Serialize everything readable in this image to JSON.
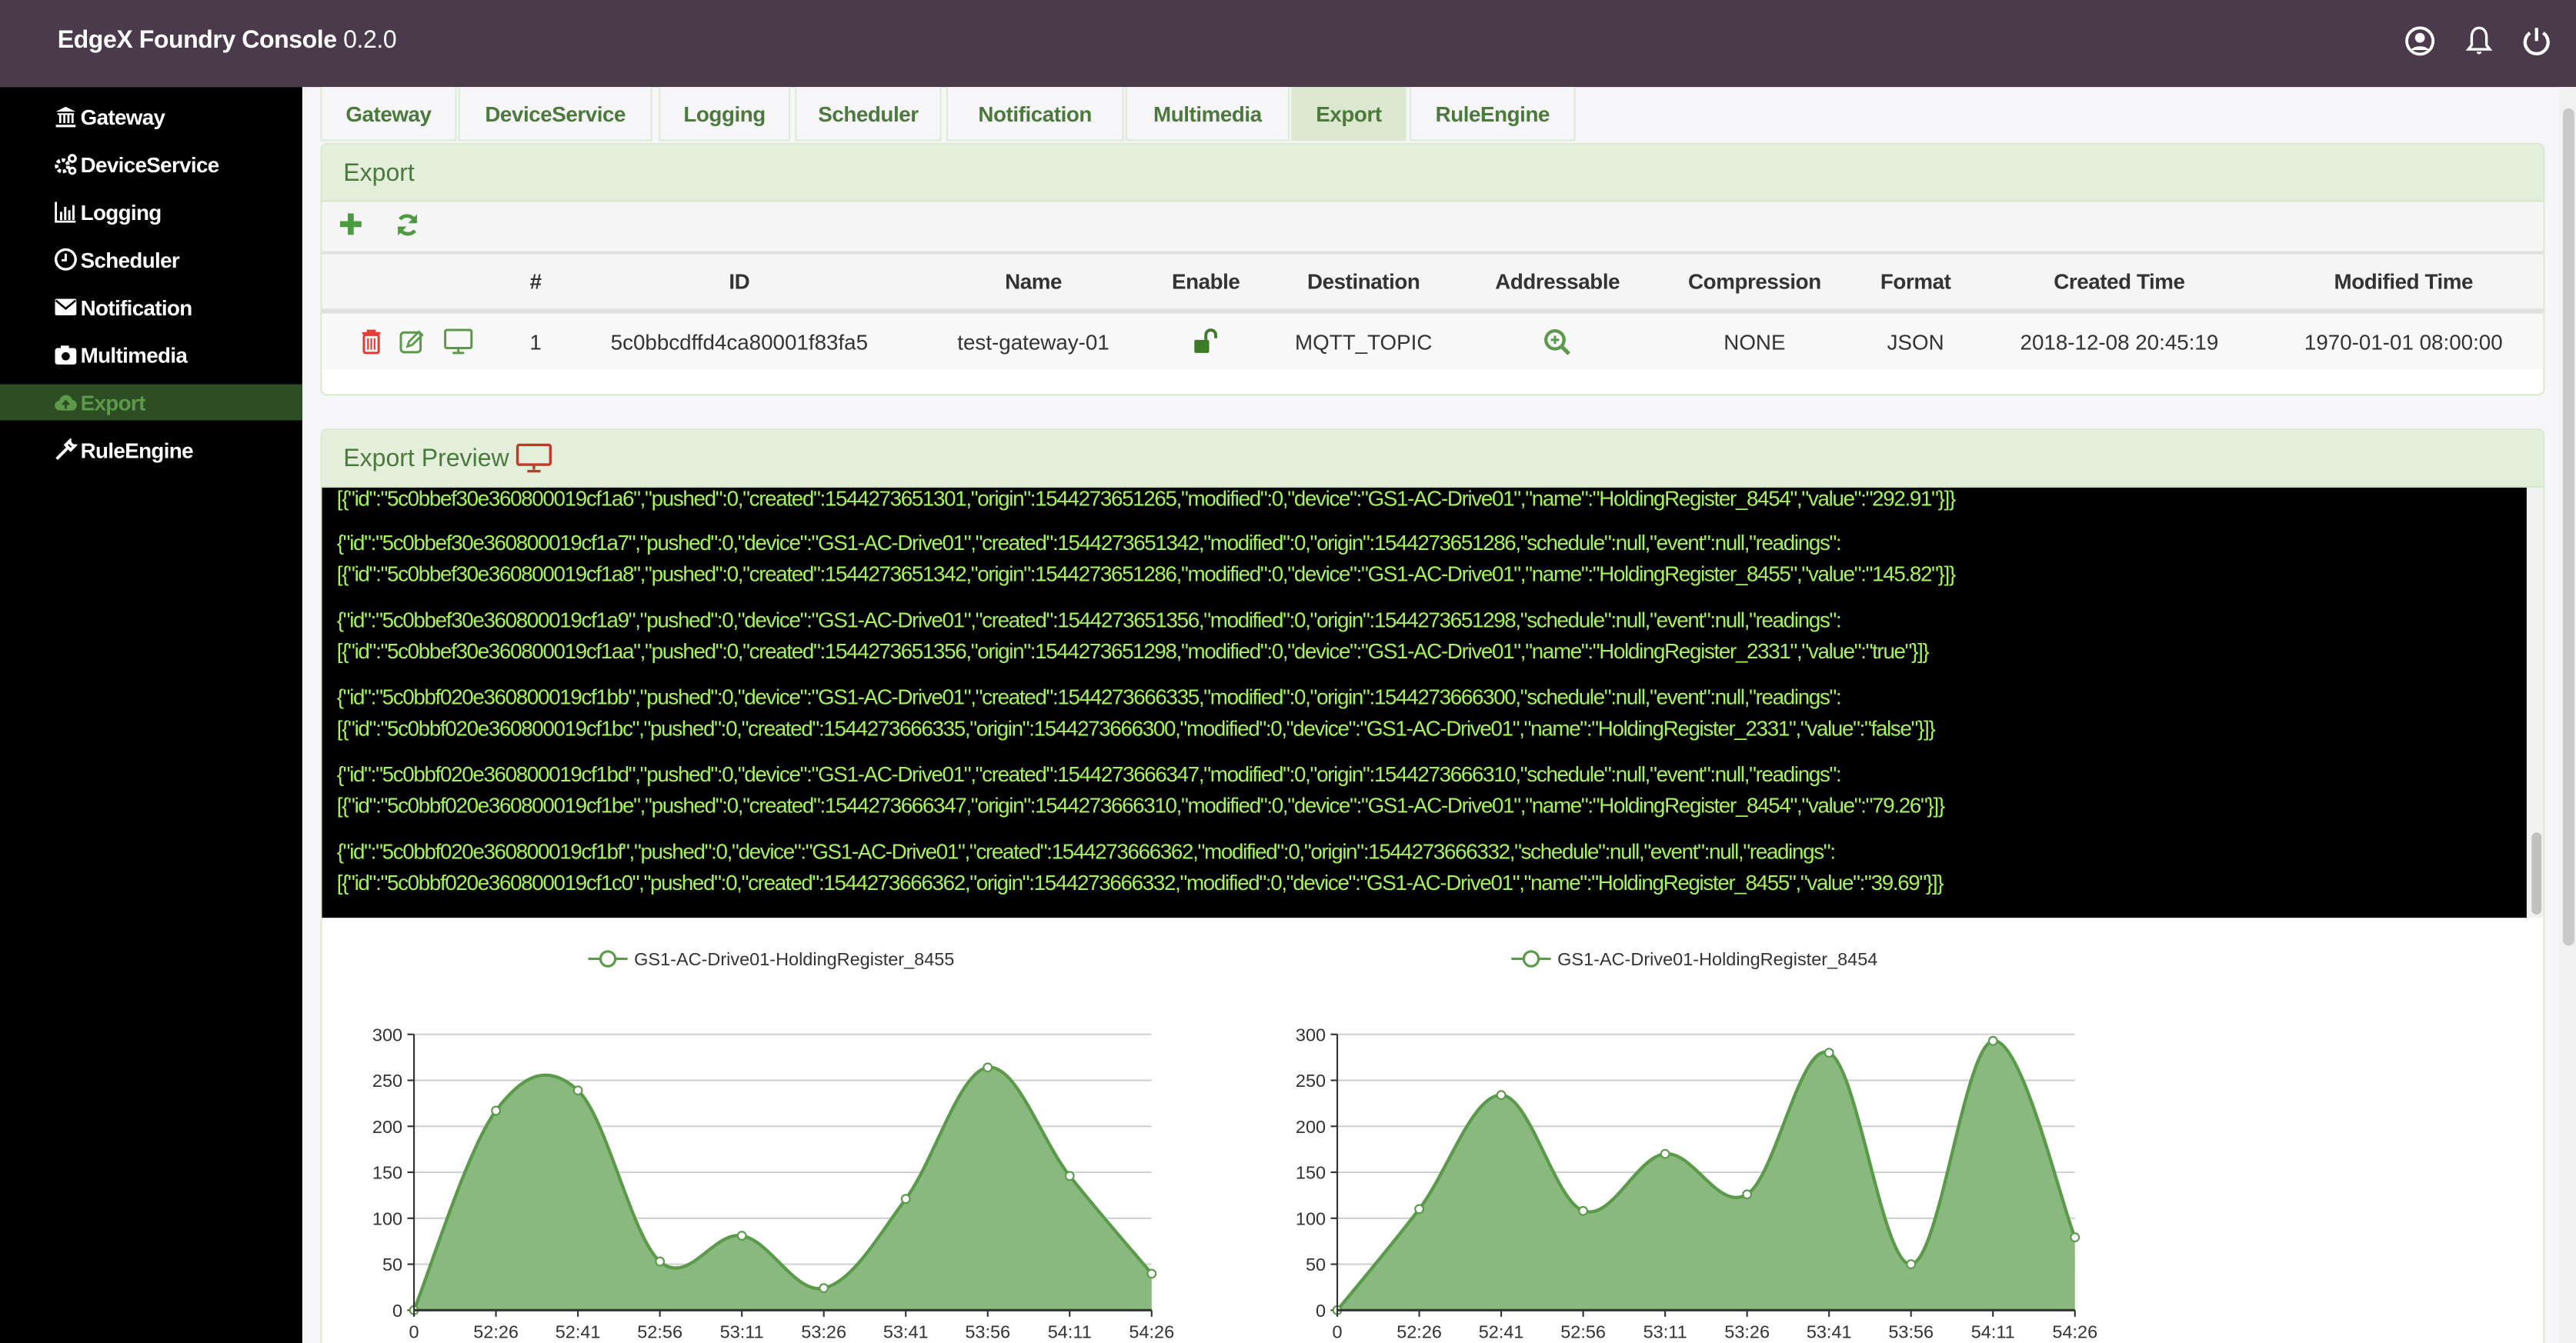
{
  "header": {
    "title": "EdgeX Foundry Console",
    "version": "0.2.0",
    "icons": [
      "user-circle-icon",
      "bell-icon",
      "power-icon"
    ]
  },
  "sidebar": {
    "items": [
      {
        "label": "Gateway",
        "icon": "bank-icon"
      },
      {
        "label": "DeviceService",
        "icon": "cogs-icon"
      },
      {
        "label": "Logging",
        "icon": "bar-chart-icon"
      },
      {
        "label": "Scheduler",
        "icon": "clock-icon"
      },
      {
        "label": "Notification",
        "icon": "envelope-icon"
      },
      {
        "label": "Multimedia",
        "icon": "camera-icon"
      },
      {
        "label": "Export",
        "icon": "cloud-upload-icon",
        "active": true
      },
      {
        "label": "RuleEngine",
        "icon": "wrench-icon"
      }
    ]
  },
  "tabs": [
    {
      "label": "Gateway"
    },
    {
      "label": "DeviceService"
    },
    {
      "label": "Logging"
    },
    {
      "label": "Scheduler"
    },
    {
      "label": "Notification"
    },
    {
      "label": "Multimedia"
    },
    {
      "label": "Export",
      "active": true
    },
    {
      "label": "RuleEngine"
    }
  ],
  "export_panel": {
    "title": "Export",
    "toolbar": {
      "add_icon": "plus-icon",
      "refresh_icon": "refresh-icon"
    },
    "columns": [
      "#",
      "ID",
      "Name",
      "Enable",
      "Destination",
      "Addressable",
      "Compression",
      "Format",
      "Created Time",
      "Modified Time"
    ],
    "rows": [
      {
        "num": "1",
        "id": "5c0bbcdffd4ca80001f83fa5",
        "name": "test-gateway-01",
        "enable": "unlock-icon",
        "destination": "MQTT_TOPIC",
        "addressable": "zoom-in-icon",
        "compression": "NONE",
        "format": "JSON",
        "created": "2018-12-08 20:45:19",
        "modified": "1970-01-01 08:00:00"
      }
    ]
  },
  "preview_panel": {
    "title": "Export Preview",
    "lines": [
      "[{\"id\":\"5c0bbef30e360800019cf1a6\",\"pushed\":0,\"created\":1544273651301,\"origin\":1544273651265,\"modified\":0,\"device\":\"GS1-AC-Drive01\",\"name\":\"HoldingRegister_8454\",\"value\":\"292.91\"}]}",
      "{\"id\":\"5c0bbef30e360800019cf1a7\",\"pushed\":0,\"device\":\"GS1-AC-Drive01\",\"created\":1544273651342,\"modified\":0,\"origin\":1544273651286,\"schedule\":null,\"event\":null,\"readings\":",
      "[{\"id\":\"5c0bbef30e360800019cf1a8\",\"pushed\":0,\"created\":1544273651342,\"origin\":1544273651286,\"modified\":0,\"device\":\"GS1-AC-Drive01\",\"name\":\"HoldingRegister_8455\",\"value\":\"145.82\"}]}",
      "{\"id\":\"5c0bbef30e360800019cf1a9\",\"pushed\":0,\"device\":\"GS1-AC-Drive01\",\"created\":1544273651356,\"modified\":0,\"origin\":1544273651298,\"schedule\":null,\"event\":null,\"readings\":",
      "[{\"id\":\"5c0bbef30e360800019cf1aa\",\"pushed\":0,\"created\":1544273651356,\"origin\":1544273651298,\"modified\":0,\"device\":\"GS1-AC-Drive01\",\"name\":\"HoldingRegister_2331\",\"value\":\"true\"}]}",
      "{\"id\":\"5c0bbf020e360800019cf1bb\",\"pushed\":0,\"device\":\"GS1-AC-Drive01\",\"created\":1544273666335,\"modified\":0,\"origin\":1544273666300,\"schedule\":null,\"event\":null,\"readings\":",
      "[{\"id\":\"5c0bbf020e360800019cf1bc\",\"pushed\":0,\"created\":1544273666335,\"origin\":1544273666300,\"modified\":0,\"device\":\"GS1-AC-Drive01\",\"name\":\"HoldingRegister_2331\",\"value\":\"false\"}]}",
      "{\"id\":\"5c0bbf020e360800019cf1bd\",\"pushed\":0,\"device\":\"GS1-AC-Drive01\",\"created\":1544273666347,\"modified\":0,\"origin\":1544273666310,\"schedule\":null,\"event\":null,\"readings\":",
      "[{\"id\":\"5c0bbf020e360800019cf1be\",\"pushed\":0,\"created\":1544273666347,\"origin\":1544273666310,\"modified\":0,\"device\":\"GS1-AC-Drive01\",\"name\":\"HoldingRegister_8454\",\"value\":\"79.26\"}]}",
      "{\"id\":\"5c0bbf020e360800019cf1bf\",\"pushed\":0,\"device\":\"GS1-AC-Drive01\",\"created\":1544273666362,\"modified\":0,\"origin\":1544273666332,\"schedule\":null,\"event\":null,\"readings\":",
      "[{\"id\":\"5c0bbf020e360800019cf1c0\",\"pushed\":0,\"created\":1544273666362,\"origin\":1544273666332,\"modified\":0,\"device\":\"GS1-AC-Drive01\",\"name\":\"HoldingRegister_8455\",\"value\":\"39.69\"}]}"
    ]
  },
  "colors": {
    "header_bg": "#4a3a4c",
    "accent_green": "#4c7a3c",
    "series_line": "#5a9a4a",
    "series_fill": "#8ab97f",
    "console_text": "#a6f25e",
    "delete_red": "#e53935"
  },
  "chart_data": [
    {
      "type": "area",
      "smooth": true,
      "legend_position": "top-center",
      "grid": "horizontal",
      "categories": [
        "0",
        "52:26",
        "52:41",
        "52:56",
        "53:11",
        "53:26",
        "53:41",
        "53:56",
        "54:11",
        "54:26"
      ],
      "yticks": [
        "0",
        "50",
        "100",
        "150",
        "200",
        "250",
        "300"
      ],
      "ylim": [
        0,
        300
      ],
      "series": [
        {
          "name": "GS1-AC-Drive01-HoldingRegister_8455",
          "values": [
            0,
            217,
            239,
            53,
            81,
            24,
            121,
            264,
            146,
            39.69
          ]
        }
      ]
    },
    {
      "type": "area",
      "smooth": true,
      "legend_position": "top-center",
      "grid": "horizontal",
      "categories": [
        "0",
        "52:26",
        "52:41",
        "52:56",
        "53:11",
        "53:26",
        "53:41",
        "53:56",
        "54:11",
        "54:26"
      ],
      "yticks": [
        "0",
        "50",
        "100",
        "150",
        "200",
        "250",
        "300"
      ],
      "ylim": [
        0,
        300
      ],
      "series": [
        {
          "name": "GS1-AC-Drive01-HoldingRegister_8454",
          "values": [
            0,
            110,
            234,
            108,
            170,
            126,
            280,
            50,
            292.91,
            79.26
          ]
        }
      ]
    }
  ]
}
